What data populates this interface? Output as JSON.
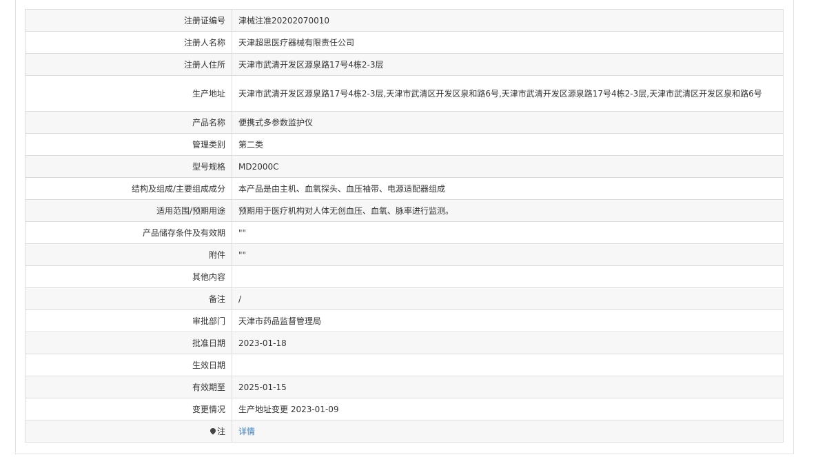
{
  "rows": [
    {
      "label": "注册证编号",
      "value": "津械注准20202070010"
    },
    {
      "label": "注册人名称",
      "value": "天津超思医疗器械有限责任公司"
    },
    {
      "label": "注册人住所",
      "value": "天津市武清开发区源泉路17号4栋2-3层"
    },
    {
      "label": "生产地址",
      "value": "天津市武清开发区源泉路17号4栋2-3层,天津市武清区开发区泉和路6号,天津市武清开发区源泉路17号4栋2-3层,天津市武清区开发区泉和路6号"
    },
    {
      "label": "产品名称",
      "value": "便携式多参数监护仪"
    },
    {
      "label": "管理类别",
      "value": "第二类"
    },
    {
      "label": "型号规格",
      "value": "MD2000C"
    },
    {
      "label": "结构及组成/主要组成成分",
      "value": "本产品是由主机、血氧探头、血压袖带、电源适配器组成"
    },
    {
      "label": "适用范围/预期用途",
      "value": "预期用于医疗机构对人体无创血压、血氧、脉率进行监测。"
    },
    {
      "label": "产品储存条件及有效期",
      "value": "\"\""
    },
    {
      "label": "附件",
      "value": "\"\""
    },
    {
      "label": "其他内容",
      "value": ""
    },
    {
      "label": "备注",
      "value": "/"
    },
    {
      "label": "审批部门",
      "value": "天津市药品监督管理局"
    },
    {
      "label": "批准日期",
      "value": "2023-01-18"
    },
    {
      "label": "生效日期",
      "value": ""
    },
    {
      "label": "有效期至",
      "value": "2025-01-15"
    },
    {
      "label": "变更情况",
      "value": "生产地址变更 2023-01-09"
    },
    {
      "label": "注",
      "value": "详情"
    }
  ],
  "colors": {
    "border": "#dcdcdc",
    "row_alt": "#f7f7f7",
    "link": "#3b7fc4"
  },
  "icons": {
    "note": "map-pin-icon"
  }
}
